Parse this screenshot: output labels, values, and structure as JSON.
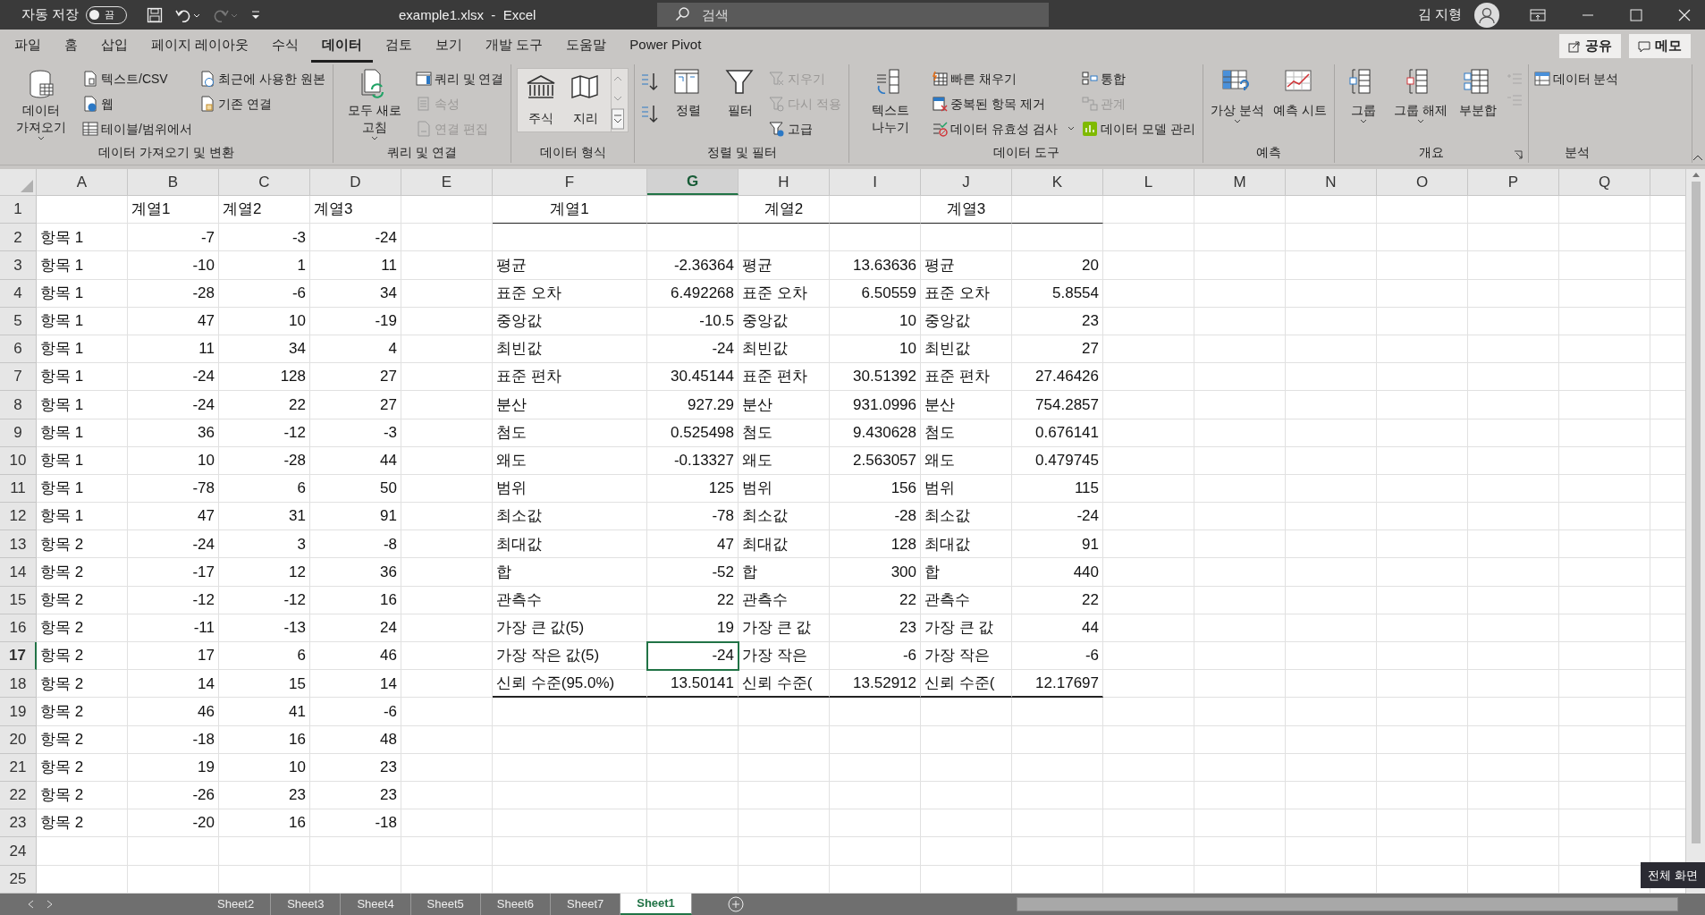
{
  "title_bar": {
    "autosave_label": "자동 저장",
    "autosave": {
      "on": false,
      "label": "끔"
    },
    "file_title": "example1.xlsx  -  Excel",
    "search": {
      "placeholder": "검색"
    },
    "user_name": "김 지형"
  },
  "tabs": [
    {
      "label": "파일",
      "selected": false
    },
    {
      "label": "홈",
      "selected": false
    },
    {
      "label": "삽입",
      "selected": false
    },
    {
      "label": "페이지 레이아웃",
      "selected": false
    },
    {
      "label": "수식",
      "selected": false
    },
    {
      "label": "데이터",
      "selected": true
    },
    {
      "label": "검토",
      "selected": false
    },
    {
      "label": "보기",
      "selected": false
    },
    {
      "label": "개발 도구",
      "selected": false
    },
    {
      "label": "도움말",
      "selected": false
    },
    {
      "label": "Power Pivot",
      "selected": false
    }
  ],
  "share_button": "공유",
  "memo_button": "메모",
  "ribbon_groups": [
    {
      "title": "데이터 가져오기 및 변환",
      "items": [
        {
          "kind": "large",
          "label": "데이터 가져오기",
          "disabled": false
        },
        {
          "kind": "small",
          "label": "텍스트/CSV",
          "disabled": false
        },
        {
          "kind": "small",
          "label": "웹",
          "disabled": false
        },
        {
          "kind": "small",
          "label": "테이블/범위에서",
          "disabled": false
        },
        {
          "kind": "small",
          "label": "최근에 사용한 원본",
          "disabled": false
        },
        {
          "kind": "small",
          "label": "기존 연결",
          "disabled": false
        }
      ]
    },
    {
      "title": "쿼리 및 연결",
      "items": [
        {
          "kind": "large",
          "label": "모두 새로 고침",
          "disabled": false
        },
        {
          "kind": "small",
          "label": "쿼리 및 연결",
          "disabled": false
        },
        {
          "kind": "small",
          "label": "속성",
          "disabled": true
        },
        {
          "kind": "small",
          "label": "연결 편집",
          "disabled": true
        }
      ]
    },
    {
      "title": "데이터 형식",
      "items": [
        {
          "kind": "gallery",
          "label": "주식",
          "disabled": false
        },
        {
          "kind": "gallery",
          "label": "지리",
          "disabled": false
        }
      ]
    },
    {
      "title": "정렬 및 필터",
      "items": [
        {
          "kind": "sort"
        },
        {
          "kind": "large",
          "label": "정렬",
          "disabled": false
        },
        {
          "kind": "large",
          "label": "필터",
          "disabled": false
        },
        {
          "kind": "small",
          "label": "지우기",
          "disabled": true
        },
        {
          "kind": "small",
          "label": "다시 적용",
          "disabled": true
        },
        {
          "kind": "small",
          "label": "고급",
          "disabled": false
        }
      ]
    },
    {
      "title": "데이터 도구",
      "items": [
        {
          "kind": "large",
          "label": "텍스트 나누기",
          "disabled": false
        },
        {
          "kind": "small",
          "label": "빠른 채우기",
          "disabled": false
        },
        {
          "kind": "small",
          "label": "중복된 항목 제거",
          "disabled": false
        },
        {
          "kind": "small",
          "label": "데이터 유효성 검사",
          "disabled": false
        },
        {
          "kind": "small",
          "label": "통합",
          "disabled": false
        },
        {
          "kind": "small",
          "label": "관계",
          "disabled": true
        },
        {
          "kind": "small",
          "label": "데이터 모델 관리",
          "disabled": false
        }
      ]
    },
    {
      "title": "예측",
      "items": [
        {
          "kind": "large",
          "label": "가상 분석",
          "disabled": false
        },
        {
          "kind": "large",
          "label": "예측 시트",
          "disabled": false
        }
      ]
    },
    {
      "title": "개요",
      "items": [
        {
          "kind": "large",
          "label": "그룹",
          "disabled": false
        },
        {
          "kind": "large",
          "label": "그룹 해제",
          "disabled": false
        },
        {
          "kind": "large",
          "label": "부분합",
          "disabled": false
        },
        {
          "kind": "detail",
          "disabled": true
        }
      ]
    },
    {
      "title": "분석",
      "items": [
        {
          "kind": "small",
          "label": "데이터 분석",
          "disabled": false
        }
      ]
    }
  ],
  "columns": [
    {
      "label": "A",
      "selected": false
    },
    {
      "label": "B",
      "selected": false
    },
    {
      "label": "C",
      "selected": false
    },
    {
      "label": "D",
      "selected": false
    },
    {
      "label": "E",
      "selected": false
    },
    {
      "label": "F",
      "selected": false
    },
    {
      "label": "G",
      "selected": true
    },
    {
      "label": "H",
      "selected": false
    },
    {
      "label": "I",
      "selected": false
    },
    {
      "label": "J",
      "selected": false
    },
    {
      "label": "K",
      "selected": false
    },
    {
      "label": "L",
      "selected": false
    },
    {
      "label": "M",
      "selected": false
    },
    {
      "label": "N",
      "selected": false
    },
    {
      "label": "O",
      "selected": false
    },
    {
      "label": "P",
      "selected": false
    },
    {
      "label": "Q",
      "selected": false
    }
  ],
  "rows": [
    {
      "label": "1",
      "selected": false,
      "cells": {
        "B": "계열1",
        "C": "계열2",
        "D": "계열3",
        "F": "계열1",
        "H": "계열2",
        "J": "계열3"
      }
    },
    {
      "label": "2",
      "selected": false,
      "cells": {
        "A": "항목 1",
        "B": "-7",
        "C": "-3",
        "D": "-24"
      }
    },
    {
      "label": "3",
      "selected": false,
      "cells": {
        "A": "항목 1",
        "B": "-10",
        "C": "1",
        "D": "11",
        "F": "평균",
        "G": "-2.36364",
        "H": "평균",
        "I": "13.63636",
        "J": "평균",
        "K": "20"
      }
    },
    {
      "label": "4",
      "selected": false,
      "cells": {
        "A": "항목 1",
        "B": "-28",
        "C": "-6",
        "D": "34",
        "F": "표준 오차",
        "G": "6.492268",
        "H": "표준 오차",
        "I": "6.50559",
        "J": "표준 오차",
        "K": "5.8554"
      }
    },
    {
      "label": "5",
      "selected": false,
      "cells": {
        "A": "항목 1",
        "B": "47",
        "C": "10",
        "D": "-19",
        "F": "중앙값",
        "G": "-10.5",
        "H": "중앙값",
        "I": "10",
        "J": "중앙값",
        "K": "23"
      }
    },
    {
      "label": "6",
      "selected": false,
      "cells": {
        "A": "항목 1",
        "B": "11",
        "C": "34",
        "D": "4",
        "F": "최빈값",
        "G": "-24",
        "H": "최빈값",
        "I": "10",
        "J": "최빈값",
        "K": "27"
      }
    },
    {
      "label": "7",
      "selected": false,
      "cells": {
        "A": "항목 1",
        "B": "-24",
        "C": "128",
        "D": "27",
        "F": "표준 편차",
        "G": "30.45144",
        "H": "표준 편차",
        "I": "30.51392",
        "J": "표준 편차",
        "K": "27.46426"
      }
    },
    {
      "label": "8",
      "selected": false,
      "cells": {
        "A": "항목 1",
        "B": "-24",
        "C": "22",
        "D": "27",
        "F": "분산",
        "G": "927.29",
        "H": "분산",
        "I": "931.0996",
        "J": "분산",
        "K": "754.2857"
      }
    },
    {
      "label": "9",
      "selected": false,
      "cells": {
        "A": "항목 1",
        "B": "36",
        "C": "-12",
        "D": "-3",
        "F": "첨도",
        "G": "0.525498",
        "H": "첨도",
        "I": "9.430628",
        "J": "첨도",
        "K": "0.676141"
      }
    },
    {
      "label": "10",
      "selected": false,
      "cells": {
        "A": "항목 1",
        "B": "10",
        "C": "-28",
        "D": "44",
        "F": "왜도",
        "G": "-0.13327",
        "H": "왜도",
        "I": "2.563057",
        "J": "왜도",
        "K": "0.479745"
      }
    },
    {
      "label": "11",
      "selected": false,
      "cells": {
        "A": "항목 1",
        "B": "-78",
        "C": "6",
        "D": "50",
        "F": "범위",
        "G": "125",
        "H": "범위",
        "I": "156",
        "J": "범위",
        "K": "115"
      }
    },
    {
      "label": "12",
      "selected": false,
      "cells": {
        "A": "항목 1",
        "B": "47",
        "C": "31",
        "D": "91",
        "F": "최소값",
        "G": "-78",
        "H": "최소값",
        "I": "-28",
        "J": "최소값",
        "K": "-24"
      }
    },
    {
      "label": "13",
      "selected": false,
      "cells": {
        "A": "항목 2",
        "B": "-24",
        "C": "3",
        "D": "-8",
        "F": "최대값",
        "G": "47",
        "H": "최대값",
        "I": "128",
        "J": "최대값",
        "K": "91"
      }
    },
    {
      "label": "14",
      "selected": false,
      "cells": {
        "A": "항목 2",
        "B": "-17",
        "C": "12",
        "D": "36",
        "F": "합",
        "G": "-52",
        "H": "합",
        "I": "300",
        "J": "합",
        "K": "440"
      }
    },
    {
      "label": "15",
      "selected": false,
      "cells": {
        "A": "항목 2",
        "B": "-12",
        "C": "-12",
        "D": "16",
        "F": "관측수",
        "G": "22",
        "H": "관측수",
        "I": "22",
        "J": "관측수",
        "K": "22"
      }
    },
    {
      "label": "16",
      "selected": false,
      "cells": {
        "A": "항목 2",
        "B": "-11",
        "C": "-13",
        "D": "24",
        "F": "가장 큰 값(5)",
        "G": "19",
        "H": "가장 큰 값",
        "I": "23",
        "J": "가장 큰 값",
        "K": "44"
      }
    },
    {
      "label": "17",
      "selected": true,
      "cells": {
        "A": "항목 2",
        "B": "17",
        "C": "6",
        "D": "46",
        "F": "가장 작은 값(5)",
        "G": "-24",
        "H": "가장 작은",
        "I": "-6",
        "J": "가장 작은",
        "K": "-6"
      }
    },
    {
      "label": "18",
      "selected": false,
      "cells": {
        "A": "항목 2",
        "B": "14",
        "C": "15",
        "D": "14",
        "F": "신뢰 수준(95.0%)",
        "G": "13.50141",
        "H": "신뢰 수준(",
        "I": "13.52912",
        "J": "신뢰 수준(",
        "K": "12.17697"
      }
    },
    {
      "label": "19",
      "selected": false,
      "cells": {
        "A": "항목 2",
        "B": "46",
        "C": "41",
        "D": "-6"
      }
    },
    {
      "label": "20",
      "selected": false,
      "cells": {
        "A": "항목 2",
        "B": "-18",
        "C": "16",
        "D": "48"
      }
    },
    {
      "label": "21",
      "selected": false,
      "cells": {
        "A": "항목 2",
        "B": "19",
        "C": "10",
        "D": "23"
      }
    },
    {
      "label": "22",
      "selected": false,
      "cells": {
        "A": "항목 2",
        "B": "-26",
        "C": "23",
        "D": "23"
      }
    },
    {
      "label": "23",
      "selected": false,
      "cells": {
        "A": "항목 2",
        "B": "-20",
        "C": "16",
        "D": "-18"
      }
    },
    {
      "label": "24",
      "selected": false,
      "cells": {}
    },
    {
      "label": "25",
      "selected": false,
      "cells": {}
    }
  ],
  "sheet_tabs": [
    {
      "label": "Sheet2",
      "selected": false
    },
    {
      "label": "Sheet3",
      "selected": false
    },
    {
      "label": "Sheet4",
      "selected": false
    },
    {
      "label": "Sheet5",
      "selected": false
    },
    {
      "label": "Sheet6",
      "selected": false
    },
    {
      "label": "Sheet7",
      "selected": false
    },
    {
      "label": "Sheet1",
      "selected": true
    }
  ],
  "tooltip": "전체 화면"
}
